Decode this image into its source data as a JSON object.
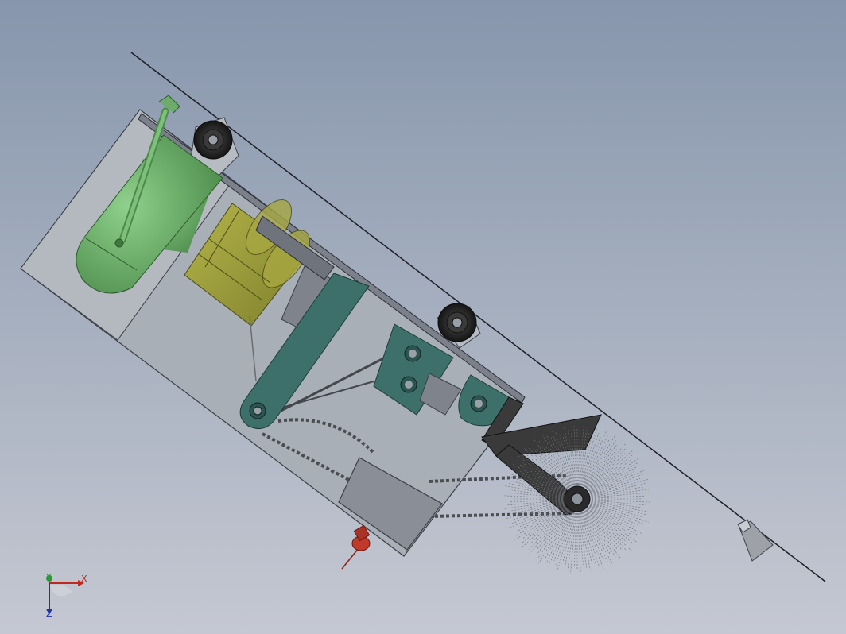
{
  "viewport": {
    "background_top": "#8796ad",
    "background_bottom": "#c5c8d2"
  },
  "model": {
    "colors": {
      "frame_plate": "#a9afb6",
      "frame_edge": "#3b3f46",
      "tank_green": "#6cab6a",
      "battery_yellow": "#9b9c3c",
      "arm_teal": "#3d6f6b",
      "bearing_black": "#222222",
      "motor_gray": "#8a8e96",
      "chain_dark": "#4a4d52",
      "brush_bristle": "#6d7076",
      "handle_dark": "#3a3a3a",
      "light_red": "#c0392b"
    },
    "components": {
      "tank": "spray-tank",
      "battery": "battery-pack",
      "brush": "rotary-brush",
      "motor": "drive-motor",
      "chain": "drive-chain",
      "arm": "swing-arm",
      "wheels": "guide-wheels",
      "nozzle": "spray-nozzle",
      "lamp": "warning-lamp"
    }
  },
  "triad": {
    "x_label": "X",
    "y_label": "Y",
    "z_label": "Z",
    "x_color": "#c0281f",
    "y_color": "#2a9a35",
    "z_color": "#2034a8"
  }
}
